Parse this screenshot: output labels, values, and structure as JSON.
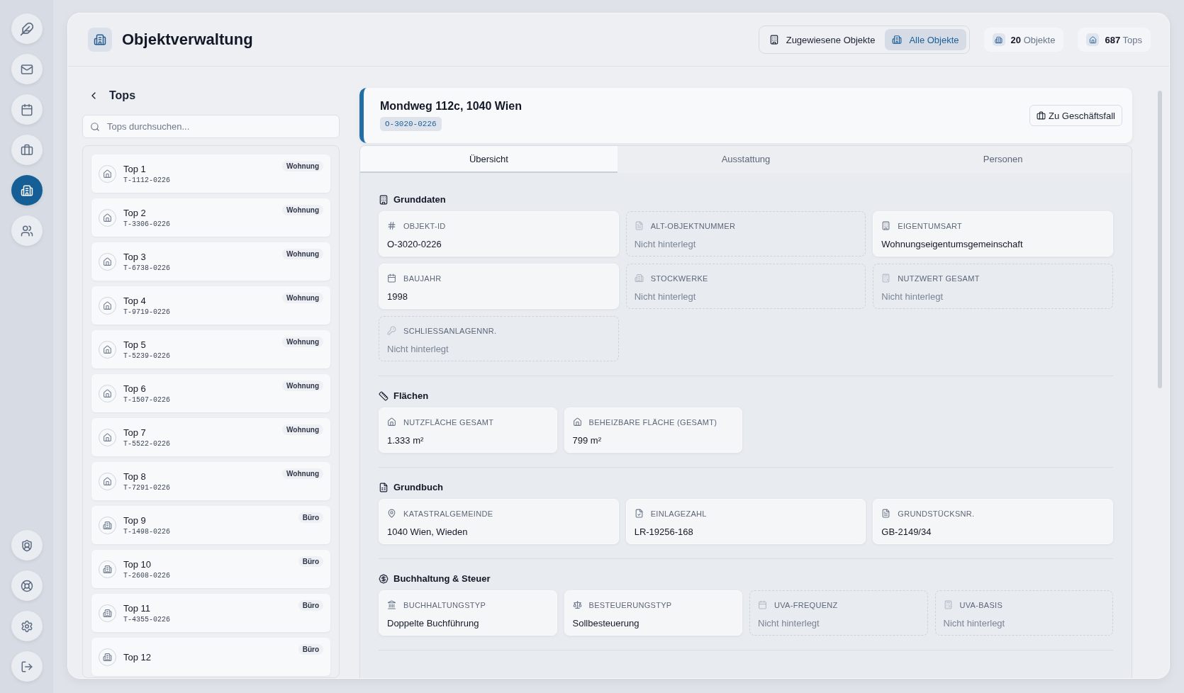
{
  "header": {
    "title": "Objektverwaltung",
    "view_toggle": [
      {
        "label": "Zugewiesene Objekte",
        "selected": false
      },
      {
        "label": "Alle Objekte",
        "selected": true
      }
    ],
    "stats": [
      {
        "value": "20",
        "label": "Objekte"
      },
      {
        "value": "687",
        "label": "Tops"
      }
    ]
  },
  "sidebar": {
    "items": [
      {
        "selected": false
      },
      {
        "selected": false
      },
      {
        "selected": false
      },
      {
        "selected": true
      },
      {
        "selected": false
      }
    ]
  },
  "tops_panel": {
    "title": "Tops",
    "search": {
      "placeholder": "Tops durchsuchen..."
    },
    "items": [
      {
        "name": "Top 1",
        "code": "T-1112-0226",
        "type": "Wohnung",
        "kind": "home"
      },
      {
        "name": "Top 2",
        "code": "T-3306-0226",
        "type": "Wohnung",
        "kind": "home"
      },
      {
        "name": "Top 3",
        "code": "T-6738-0226",
        "type": "Wohnung",
        "kind": "home"
      },
      {
        "name": "Top 4",
        "code": "T-9719-0226",
        "type": "Wohnung",
        "kind": "home"
      },
      {
        "name": "Top 5",
        "code": "T-5239-0226",
        "type": "Wohnung",
        "kind": "home"
      },
      {
        "name": "Top 6",
        "code": "T-1507-0226",
        "type": "Wohnung",
        "kind": "home"
      },
      {
        "name": "Top 7",
        "code": "T-5522-0226",
        "type": "Wohnung",
        "kind": "home"
      },
      {
        "name": "Top 8",
        "code": "T-7291-0226",
        "type": "Wohnung",
        "kind": "home"
      },
      {
        "name": "Top 9",
        "code": "T-1498-0226",
        "type": "Büro",
        "kind": "office"
      },
      {
        "name": "Top 10",
        "code": "T-2608-0226",
        "type": "Büro",
        "kind": "office"
      },
      {
        "name": "Top 11",
        "code": "T-4355-0226",
        "type": "Büro",
        "kind": "office"
      },
      {
        "name": "Top 12",
        "type": "Büro",
        "kind": "office"
      }
    ]
  },
  "detail": {
    "address": "Mondweg 112c, 1040 Wien",
    "object_id": "O-3020-0226",
    "action": "Zu Geschäftsfall",
    "tabs": [
      {
        "label": "Übersicht",
        "selected": true
      },
      {
        "label": "Ausstattung",
        "selected": false
      },
      {
        "label": "Personen",
        "selected": false
      }
    ],
    "sections": [
      {
        "title": "Grunddaten",
        "fields": [
          {
            "label": "OBJEKT-ID",
            "value": "O-3020-0226",
            "kind": "value"
          },
          {
            "label": "ALT-OBJEKTNUMMER",
            "value": "Nicht hinterlegt",
            "kind": "missing"
          },
          {
            "label": "EIGENTUMSART",
            "value": "Wohnungseigentumsgemeinschaft",
            "kind": "value"
          },
          {
            "label": "BAUJAHR",
            "value": "1998",
            "kind": "value"
          },
          {
            "label": "STOCKWERKE",
            "value": "Nicht hinterlegt",
            "kind": "missing"
          },
          {
            "label": "NUTZWERT GESAMT",
            "value": "Nicht hinterlegt",
            "kind": "missing"
          },
          {
            "label": "SCHLIESSANLAGENNR.",
            "value": "Nicht hinterlegt",
            "kind": "missing"
          }
        ]
      },
      {
        "title": "Flächen",
        "fields": [
          {
            "label": "NUTZFLÄCHE GESAMT",
            "value": "1.333 m²",
            "kind": "value"
          },
          {
            "label": "BEHEIZBARE FLÄCHE (GESAMT)",
            "value": "799 m²",
            "kind": "value"
          }
        ]
      },
      {
        "title": "Grundbuch",
        "fields": [
          {
            "label": "KATASTRALGEMEINDE",
            "value": "1040 Wien, Wieden",
            "kind": "value"
          },
          {
            "label": "EINLAGEZAHL",
            "value": "LR-19256-168",
            "kind": "value"
          },
          {
            "label": "GRUNDSTÜCKSNR.",
            "value": "GB-2149/34",
            "kind": "value"
          }
        ]
      },
      {
        "title": "Buchhaltung & Steuer",
        "fields": [
          {
            "label": "BUCHHALTUNGSTYP",
            "value": "Doppelte Buchführung",
            "kind": "value"
          },
          {
            "label": "BESTEUERUNGSTYP",
            "value": "Sollbesteuerung",
            "kind": "value"
          },
          {
            "label": "UVA-FREQUENZ",
            "value": "Nicht hinterlegt",
            "kind": "missing"
          },
          {
            "label": "UVA-BASIS",
            "value": "Nicht hinterlegt",
            "kind": "missing"
          }
        ]
      }
    ]
  }
}
